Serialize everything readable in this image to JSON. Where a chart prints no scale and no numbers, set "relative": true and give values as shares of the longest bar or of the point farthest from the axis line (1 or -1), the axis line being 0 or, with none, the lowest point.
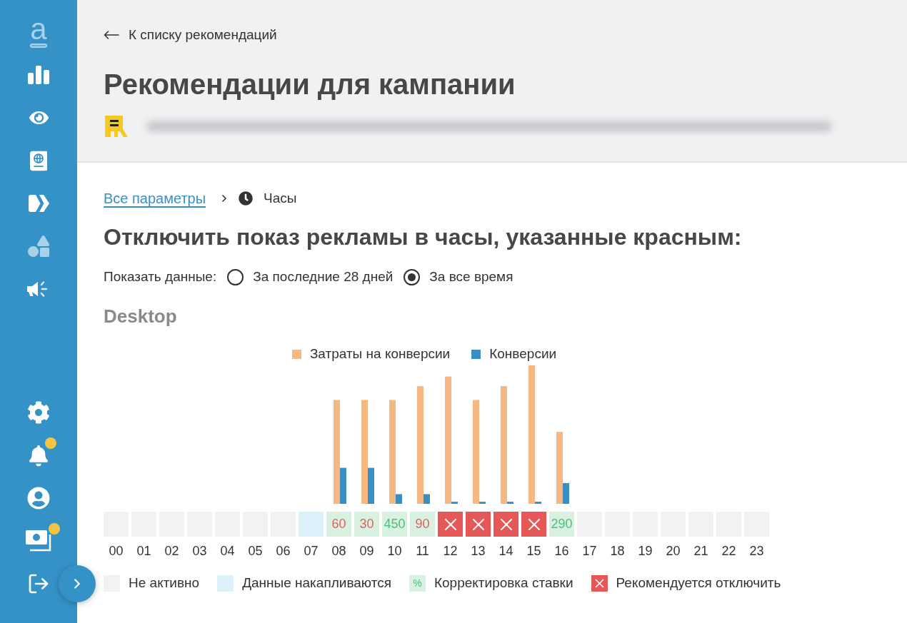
{
  "sidebar": {
    "logo": "a",
    "top_items": [
      {
        "kind": "stats"
      },
      {
        "kind": "eye"
      },
      {
        "kind": "passport"
      },
      {
        "kind": "forward"
      },
      {
        "kind": "shapes"
      },
      {
        "kind": "megaphone"
      }
    ],
    "bottom_items": [
      {
        "kind": "settings",
        "notification": false
      },
      {
        "kind": "bell",
        "notification": true
      },
      {
        "kind": "user",
        "notification": false
      },
      {
        "kind": "money",
        "notification": true
      },
      {
        "kind": "logout",
        "notification": false
      }
    ]
  },
  "header": {
    "back_link": "К списку рекомендаций",
    "title": "Рекомендации для кампании"
  },
  "breadcrumb": {
    "link": "Все параметры",
    "current": "Часы"
  },
  "heading": "Отключить показ рекламы в часы, указанные красным:",
  "data_range": {
    "label": "Показать данные:",
    "options": [
      {
        "label": "За последние 28 дней",
        "selected": false
      },
      {
        "label": "За все время",
        "selected": true
      }
    ]
  },
  "device": {
    "title": "Desktop",
    "chart_data": {
      "type": "bar",
      "relative": true,
      "legend": "top",
      "categories": [
        "00",
        "01",
        "02",
        "03",
        "04",
        "05",
        "06",
        "07",
        "08",
        "09",
        "10",
        "11",
        "12",
        "13",
        "14",
        "15",
        "16",
        "17",
        "18",
        "19",
        "20",
        "21",
        "22",
        "23"
      ],
      "series": [
        {
          "name": "Затраты на конверсии",
          "color": "#f6b882",
          "values": [
            0,
            0,
            0,
            0,
            0,
            0,
            0,
            0,
            0.75,
            0.75,
            0.75,
            0.85,
            0.92,
            0.75,
            0.85,
            1,
            0.52,
            0,
            0,
            0,
            0,
            0,
            0,
            0
          ]
        },
        {
          "name": "Конверсии",
          "color": "#3a8fc2",
          "values": [
            0,
            0,
            0,
            0,
            0,
            0,
            0,
            0,
            0.26,
            0.26,
            0.07,
            0.07,
            0.015,
            0.015,
            0.015,
            0.015,
            0.15,
            0,
            0,
            0,
            0,
            0,
            0,
            0
          ]
        }
      ]
    },
    "hours": [
      {
        "kind": "inactive"
      },
      {
        "kind": "inactive"
      },
      {
        "kind": "inactive"
      },
      {
        "kind": "inactive"
      },
      {
        "kind": "inactive"
      },
      {
        "kind": "inactive"
      },
      {
        "kind": "inactive"
      },
      {
        "kind": "accumulating"
      },
      {
        "kind": "adjust",
        "value": "60",
        "color": "#e2605c"
      },
      {
        "kind": "adjust",
        "value": "30",
        "color": "#e2605c"
      },
      {
        "kind": "adjust",
        "value": "450",
        "color": "#4cc17d"
      },
      {
        "kind": "adjust",
        "value": "90",
        "color": "#e2605c"
      },
      {
        "kind": "disable"
      },
      {
        "kind": "disable"
      },
      {
        "kind": "disable"
      },
      {
        "kind": "disable"
      },
      {
        "kind": "adjust",
        "value": "290",
        "color": "#4cc17d"
      },
      {
        "kind": "inactive"
      },
      {
        "kind": "inactive"
      },
      {
        "kind": "inactive"
      },
      {
        "kind": "inactive"
      },
      {
        "kind": "inactive"
      },
      {
        "kind": "inactive"
      },
      {
        "kind": "inactive"
      }
    ]
  },
  "legend": [
    {
      "kind": "inactive",
      "label": "Не активно"
    },
    {
      "kind": "accumulating",
      "label": "Данные накапливаются"
    },
    {
      "kind": "adjust",
      "symbol": "%",
      "label": "Корректировка ставки"
    },
    {
      "kind": "disable",
      "label": "Рекомендуется отключить"
    }
  ]
}
